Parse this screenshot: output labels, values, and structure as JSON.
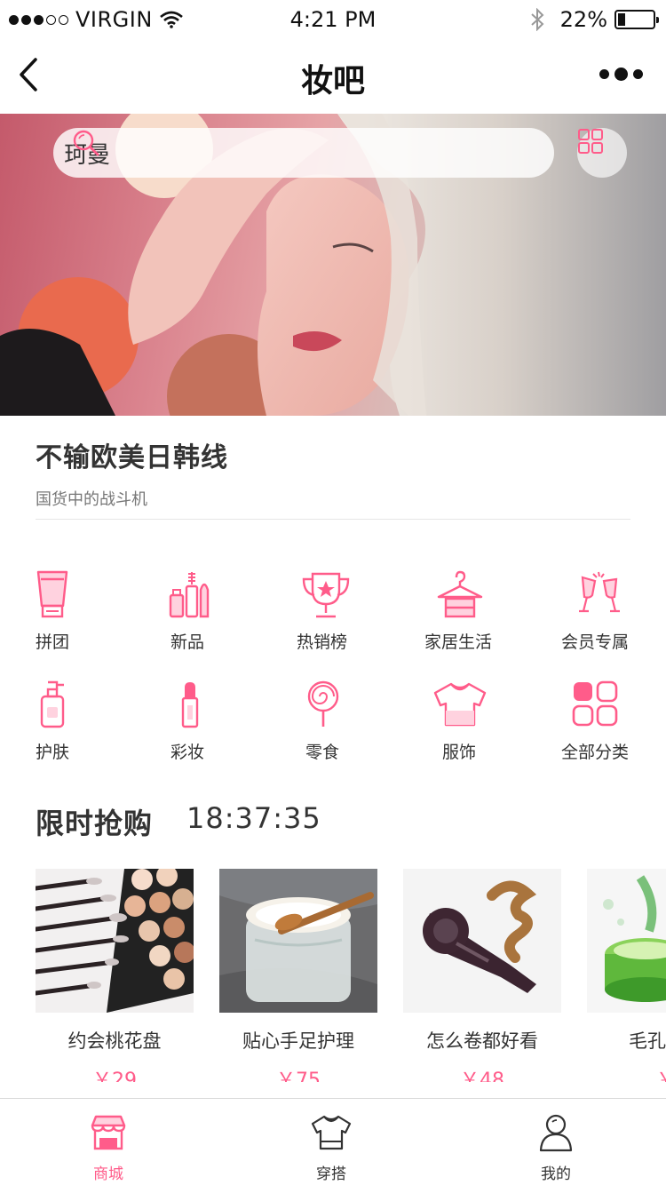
{
  "status_bar": {
    "carrier": "VIRGIN",
    "time": "4:21 PM",
    "battery_percent": "22%",
    "battery_level": 0.22,
    "icons": [
      "signal-dots-icon",
      "wifi-icon",
      "bluetooth-icon",
      "battery-icon"
    ]
  },
  "nav": {
    "title": "妆吧",
    "back_icon": "chevron-left-icon",
    "more_icon": "more-dots-icon"
  },
  "search": {
    "query": "珂曼",
    "icon": "search-icon",
    "grid_icon": "grid-icon"
  },
  "promo": {
    "title": "不输欧美日韩线",
    "subtitle": "国货中的战斗机"
  },
  "categories": [
    {
      "label": "拼团",
      "icon": "tube-icon"
    },
    {
      "label": "新品",
      "icon": "cosmetics-icon"
    },
    {
      "label": "热销榜",
      "icon": "trophy-icon"
    },
    {
      "label": "家居生活",
      "icon": "hanger-icon"
    },
    {
      "label": "会员专属",
      "icon": "champagne-icon"
    },
    {
      "label": "护肤",
      "icon": "lotion-bottle-icon"
    },
    {
      "label": "彩妆",
      "icon": "lipstick-icon"
    },
    {
      "label": "零食",
      "icon": "lollipop-icon"
    },
    {
      "label": "服饰",
      "icon": "tshirt-icon"
    },
    {
      "label": "全部分类",
      "icon": "all-categories-icon"
    }
  ],
  "flash_sale": {
    "title": "限时抢购",
    "countdown": "18:37:35"
  },
  "products": [
    {
      "name": "约会桃花盘",
      "price": "￥29"
    },
    {
      "name": "贴心手足护理",
      "price": "￥75"
    },
    {
      "name": "怎么卷都好看",
      "price": "￥48"
    },
    {
      "name": "毛孔清爽",
      "price": "￥"
    }
  ],
  "tabs": [
    {
      "label": "商城",
      "icon": "store-icon",
      "active": true
    },
    {
      "label": "穿搭",
      "icon": "tshirt-icon",
      "active": false
    },
    {
      "label": "我的",
      "icon": "user-icon",
      "active": false
    }
  ],
  "colors": {
    "accent": "#ff5c8a",
    "text": "#333333",
    "divider": "#e6e6e6"
  }
}
